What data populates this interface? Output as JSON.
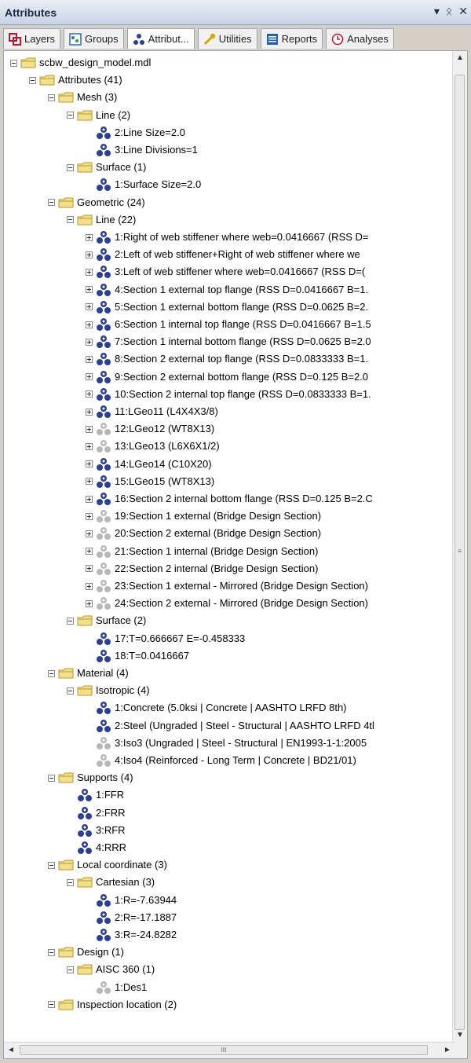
{
  "window": {
    "title": "Attributes",
    "controls": [
      "▾",
      "ᛟ",
      "✕"
    ]
  },
  "tabs": [
    {
      "label": "Layers",
      "icon": "layers-icon",
      "active": false
    },
    {
      "label": "Groups",
      "icon": "groups-icon",
      "active": false
    },
    {
      "label": "Attribut...",
      "icon": "attributes-icon",
      "active": true
    },
    {
      "label": "Utilities",
      "icon": "utilities-icon",
      "active": false
    },
    {
      "label": "Reports",
      "icon": "reports-icon",
      "active": false
    },
    {
      "label": "Analyses",
      "icon": "analyses-icon",
      "active": false
    }
  ],
  "colors": {
    "attribute_active": "#2a3f9a",
    "attribute_inactive": "#b8b8b8",
    "folder_fill": "#f3e08a",
    "folder_stroke": "#b49a2a"
  },
  "tree": [
    {
      "level": 0,
      "exp": "minus",
      "icon": "folder",
      "label": "scbw_design_model.mdl"
    },
    {
      "level": 1,
      "exp": "minus",
      "icon": "folder",
      "label": "Attributes (41)"
    },
    {
      "level": 2,
      "exp": "minus",
      "icon": "folder",
      "label": "Mesh (3)"
    },
    {
      "level": 3,
      "exp": "minus",
      "icon": "folder",
      "label": "Line (2)"
    },
    {
      "level": 4,
      "exp": "none",
      "icon": "attr",
      "label": "2:Line Size=2.0"
    },
    {
      "level": 4,
      "exp": "none",
      "icon": "attr",
      "label": "3:Line Divisions=1"
    },
    {
      "level": 3,
      "exp": "minus",
      "icon": "folder",
      "label": "Surface (1)"
    },
    {
      "level": 4,
      "exp": "none",
      "icon": "attr",
      "label": "1:Surface Size=2.0"
    },
    {
      "level": 2,
      "exp": "minus",
      "icon": "folder",
      "label": "Geometric (24)"
    },
    {
      "level": 3,
      "exp": "minus",
      "icon": "folder",
      "label": "Line (22)"
    },
    {
      "level": 4,
      "exp": "plus",
      "icon": "attr",
      "label": "1:Right of web stiffener where web=0.0416667 (RSS D="
    },
    {
      "level": 4,
      "exp": "plus",
      "icon": "attr",
      "label": "2:Left of web stiffener+Right of web stiffener where we"
    },
    {
      "level": 4,
      "exp": "plus",
      "icon": "attr",
      "label": "3:Left of web stiffener where web=0.0416667 (RSS D=("
    },
    {
      "level": 4,
      "exp": "plus",
      "icon": "attr",
      "label": "4:Section 1 external top flange (RSS D=0.0416667 B=1."
    },
    {
      "level": 4,
      "exp": "plus",
      "icon": "attr",
      "label": "5:Section 1 external bottom flange (RSS D=0.0625 B=2."
    },
    {
      "level": 4,
      "exp": "plus",
      "icon": "attr",
      "label": "6:Section 1 internal top flange (RSS D=0.0416667 B=1.5"
    },
    {
      "level": 4,
      "exp": "plus",
      "icon": "attr",
      "label": "7:Section 1 internal bottom flange (RSS D=0.0625 B=2.0"
    },
    {
      "level": 4,
      "exp": "plus",
      "icon": "attr",
      "label": "8:Section 2 external top flange (RSS D=0.0833333 B=1."
    },
    {
      "level": 4,
      "exp": "plus",
      "icon": "attr",
      "label": "9:Section 2 external bottom flange (RSS D=0.125 B=2.0"
    },
    {
      "level": 4,
      "exp": "plus",
      "icon": "attr",
      "label": "10:Section 2 internal top flange (RSS D=0.0833333 B=1."
    },
    {
      "level": 4,
      "exp": "plus",
      "icon": "attr",
      "label": "11:LGeo11 (L4X4X3/8)"
    },
    {
      "level": 4,
      "exp": "plus",
      "icon": "attr-inactive",
      "label": "12:LGeo12 (WT8X13)"
    },
    {
      "level": 4,
      "exp": "plus",
      "icon": "attr-inactive",
      "label": "13:LGeo13 (L6X6X1/2)"
    },
    {
      "level": 4,
      "exp": "plus",
      "icon": "attr",
      "label": "14:LGeo14 (C10X20)"
    },
    {
      "level": 4,
      "exp": "plus",
      "icon": "attr",
      "label": "15:LGeo15 (WT8X13)"
    },
    {
      "level": 4,
      "exp": "plus",
      "icon": "attr",
      "label": "16:Section 2 internal bottom flange (RSS D=0.125 B=2.C"
    },
    {
      "level": 4,
      "exp": "plus",
      "icon": "attr-inactive",
      "label": "19:Section 1 external (Bridge Design Section)"
    },
    {
      "level": 4,
      "exp": "plus",
      "icon": "attr-inactive",
      "label": "20:Section 2 external (Bridge Design Section)"
    },
    {
      "level": 4,
      "exp": "plus",
      "icon": "attr-inactive",
      "label": "21:Section 1 internal (Bridge Design Section)"
    },
    {
      "level": 4,
      "exp": "plus",
      "icon": "attr-inactive",
      "label": "22:Section 2 internal (Bridge Design Section)"
    },
    {
      "level": 4,
      "exp": "plus",
      "icon": "attr-inactive",
      "label": "23:Section 1 external - Mirrored (Bridge Design Section)"
    },
    {
      "level": 4,
      "exp": "plus",
      "icon": "attr-inactive",
      "label": "24:Section 2 external - Mirrored (Bridge Design Section)"
    },
    {
      "level": 3,
      "exp": "minus",
      "icon": "folder",
      "label": "Surface (2)"
    },
    {
      "level": 4,
      "exp": "none",
      "icon": "attr",
      "label": "17:T=0.666667 E=-0.458333"
    },
    {
      "level": 4,
      "exp": "none",
      "icon": "attr",
      "label": "18:T=0.0416667"
    },
    {
      "level": 2,
      "exp": "minus",
      "icon": "folder",
      "label": "Material (4)"
    },
    {
      "level": 3,
      "exp": "minus",
      "icon": "folder",
      "label": "Isotropic (4)"
    },
    {
      "level": 4,
      "exp": "none",
      "icon": "attr",
      "label": "1:Concrete (5.0ksi | Concrete | AASHTO LRFD 8th)"
    },
    {
      "level": 4,
      "exp": "none",
      "icon": "attr",
      "label": "2:Steel (Ungraded | Steel - Structural | AASHTO LRFD 4tl"
    },
    {
      "level": 4,
      "exp": "none",
      "icon": "attr-inactive",
      "label": "3:Iso3 (Ungraded | Steel - Structural | EN1993-1-1:2005"
    },
    {
      "level": 4,
      "exp": "none",
      "icon": "attr-inactive",
      "label": "4:Iso4 (Reinforced - Long Term | Concrete | BD21/01)"
    },
    {
      "level": 2,
      "exp": "minus",
      "icon": "folder",
      "label": "Supports (4)"
    },
    {
      "level": 3,
      "exp": "none",
      "icon": "attr",
      "label": "1:FFR"
    },
    {
      "level": 3,
      "exp": "none",
      "icon": "attr",
      "label": "2:FRR"
    },
    {
      "level": 3,
      "exp": "none",
      "icon": "attr",
      "label": "3:RFR"
    },
    {
      "level": 3,
      "exp": "none",
      "icon": "attr",
      "label": "4:RRR"
    },
    {
      "level": 2,
      "exp": "minus",
      "icon": "folder",
      "label": "Local coordinate (3)"
    },
    {
      "level": 3,
      "exp": "minus",
      "icon": "folder",
      "label": "Cartesian (3)"
    },
    {
      "level": 4,
      "exp": "none",
      "icon": "attr",
      "label": "1:R=-7.63944"
    },
    {
      "level": 4,
      "exp": "none",
      "icon": "attr",
      "label": "2:R=-17.1887"
    },
    {
      "level": 4,
      "exp": "none",
      "icon": "attr",
      "label": "3:R=-24.8282"
    },
    {
      "level": 2,
      "exp": "minus",
      "icon": "folder",
      "label": "Design (1)"
    },
    {
      "level": 3,
      "exp": "minus",
      "icon": "folder",
      "label": "AISC 360 (1)"
    },
    {
      "level": 4,
      "exp": "none",
      "icon": "attr-inactive",
      "label": "1:Des1"
    },
    {
      "level": 2,
      "exp": "minus",
      "icon": "folder",
      "label": "Inspection location (2)"
    }
  ],
  "scroll": {
    "v_up": "▲",
    "v_down": "▼",
    "h_left": "◄",
    "h_right": "►",
    "grip": "III"
  }
}
